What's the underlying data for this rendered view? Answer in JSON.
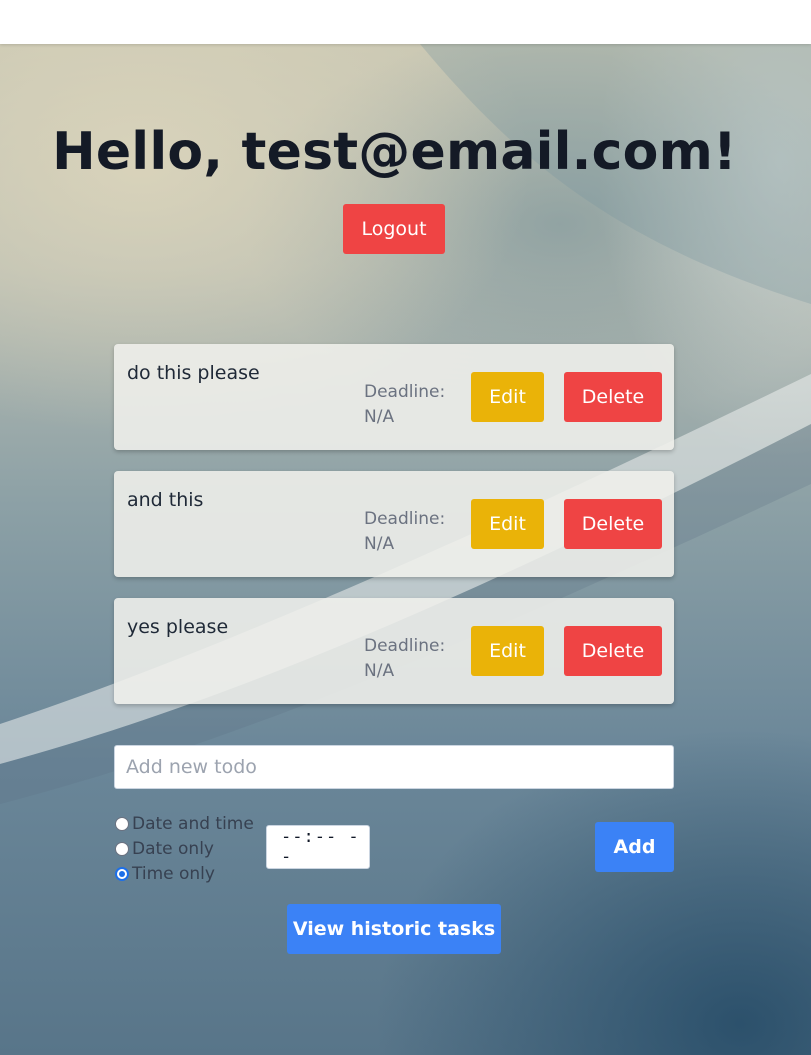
{
  "header": {
    "greeting": "Hello, test@email.com!",
    "logout_label": "Logout"
  },
  "todos": [
    {
      "title": "do this please",
      "deadline": "Deadline: N/A",
      "edit_label": "Edit",
      "delete_label": "Delete"
    },
    {
      "title": "and this",
      "deadline": "Deadline: N/A",
      "edit_label": "Edit",
      "delete_label": "Delete"
    },
    {
      "title": "yes please",
      "deadline": "Deadline: N/A",
      "edit_label": "Edit",
      "delete_label": "Delete"
    }
  ],
  "new_todo": {
    "placeholder": "Add new todo",
    "value": ""
  },
  "deadline_options": [
    {
      "label": "Date and time",
      "checked": false
    },
    {
      "label": "Date only",
      "checked": false
    },
    {
      "label": "Time only",
      "checked": true
    }
  ],
  "time_input": {
    "value": "--:-- --"
  },
  "actions": {
    "add_label": "Add",
    "historic_label": "View historic tasks"
  },
  "colors": {
    "danger": "#ef4444",
    "warning": "#eab308",
    "primary": "#3b82f6",
    "radio_checked": "#1d6fe8"
  }
}
